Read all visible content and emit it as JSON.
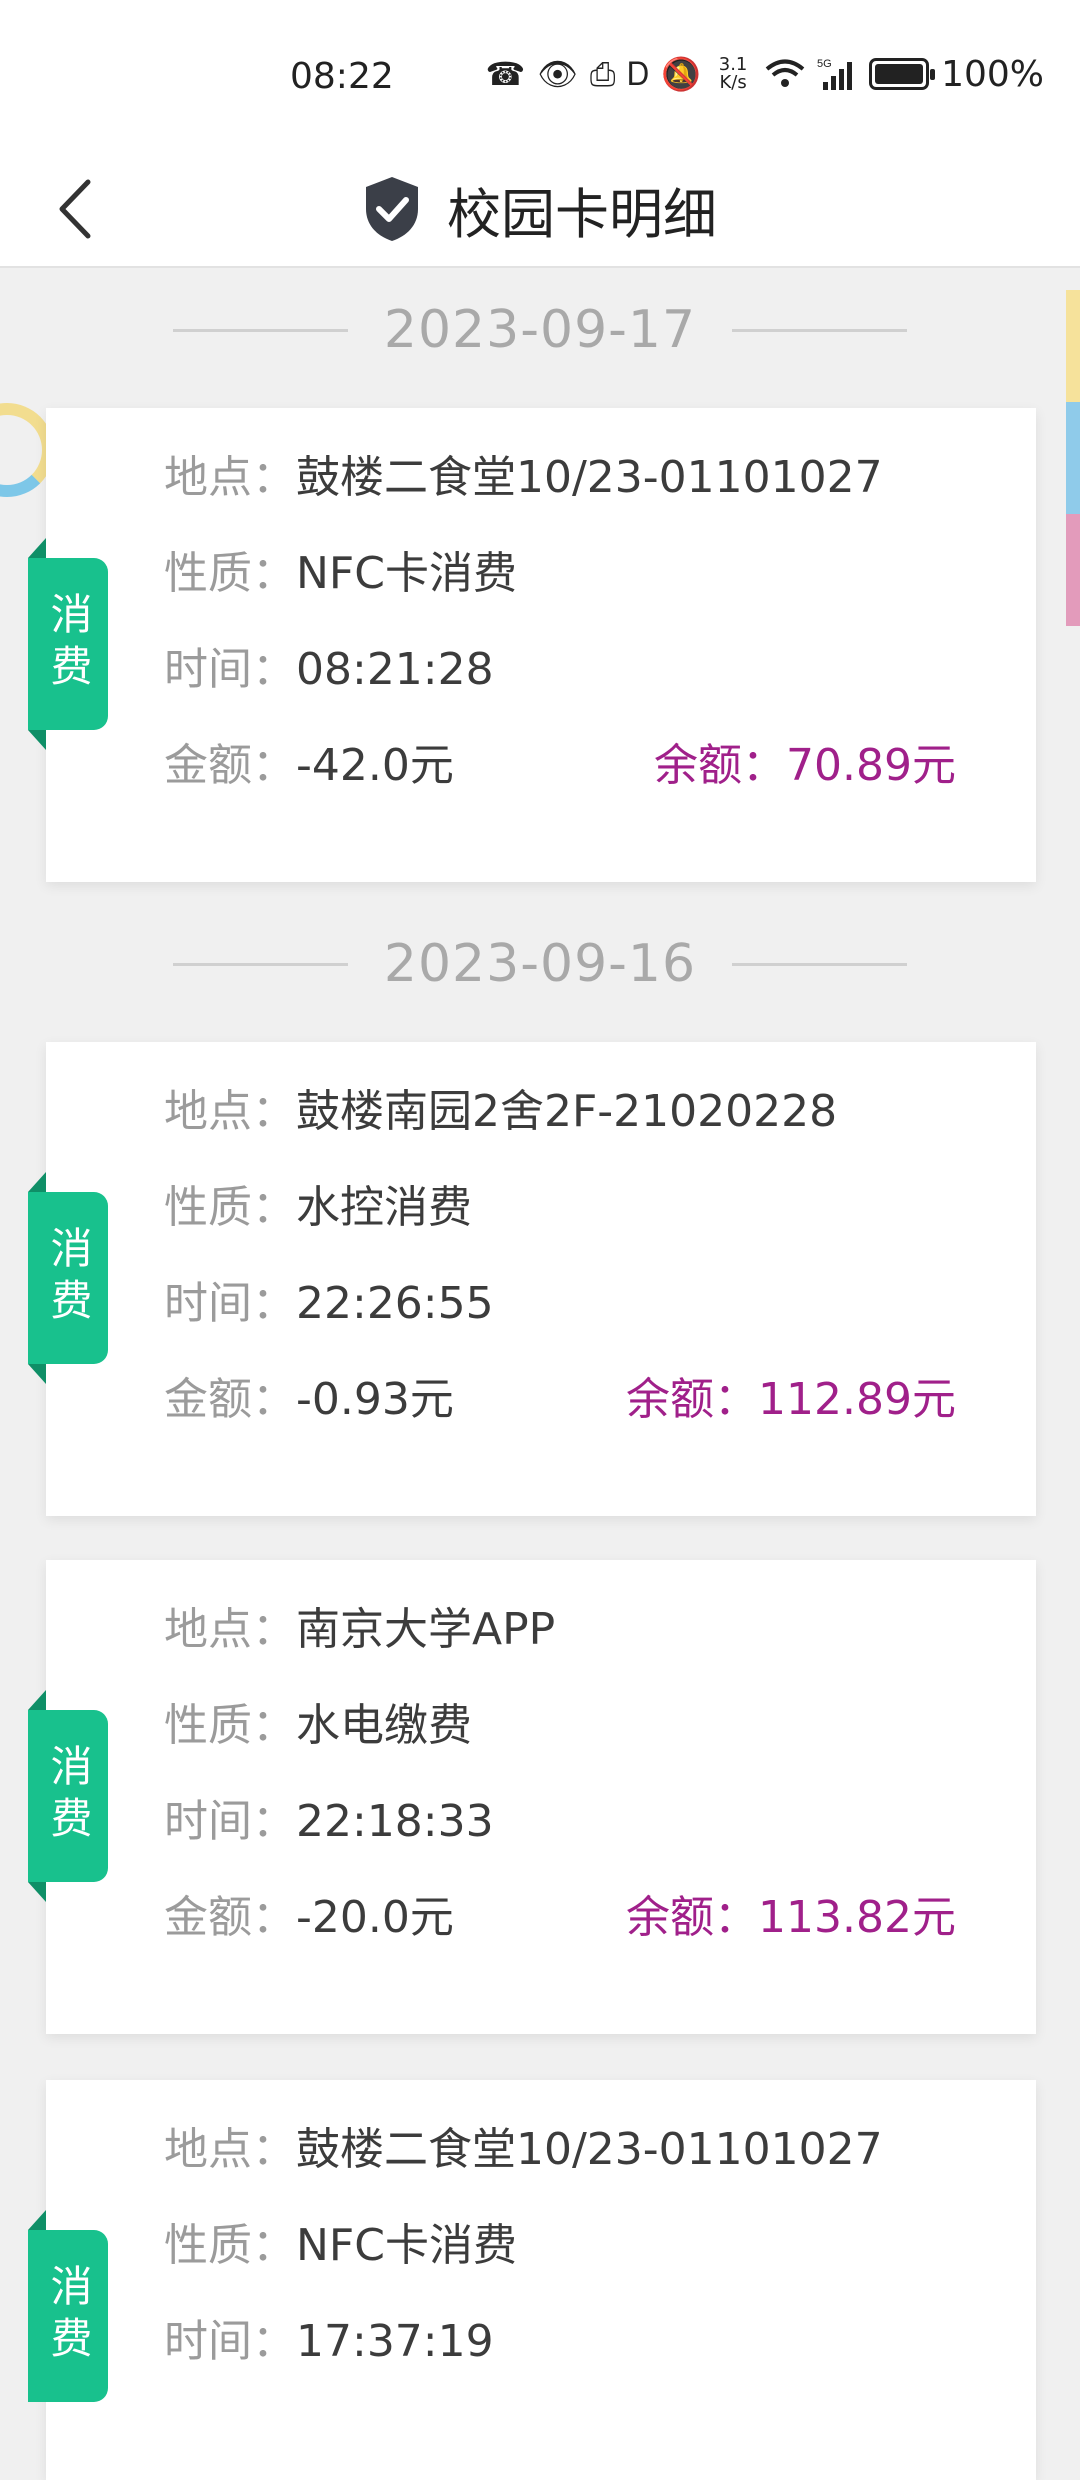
{
  "status_bar": {
    "time": "08:22",
    "speed": "3.1\nK/s",
    "battery_pct": "100%",
    "network": "5G"
  },
  "header": {
    "title": "校园卡明细",
    "back_icon": "chevron-left-icon",
    "shield_icon": "shield-check-icon"
  },
  "labels": {
    "location": "地点：",
    "nature": "性质：",
    "time": "时间：",
    "amount": "金额：",
    "balance": "余额："
  },
  "groups": [
    {
      "date": "2023-09-17",
      "records": [
        {
          "badge": "消费",
          "location": "鼓楼二食堂10/23-01101027",
          "nature": "NFC卡消费",
          "time": "08:21:28",
          "amount": "-42.0元",
          "balance": "余额：70.89元"
        }
      ]
    },
    {
      "date": "2023-09-16",
      "records": [
        {
          "badge": "消费",
          "location": "鼓楼南园2舍2F-21020228",
          "nature": "水控消费",
          "time": "22:26:55",
          "amount": "-0.93元",
          "balance": "余额：112.89元"
        },
        {
          "badge": "消费",
          "location": "南京大学APP",
          "nature": "水电缴费",
          "time": "22:18:33",
          "amount": "-20.0元",
          "balance": "余额：113.82元"
        },
        {
          "badge": "消费",
          "location": "鼓楼二食堂10/23-01101027",
          "nature": "NFC卡消费",
          "time": "17:37:19"
        }
      ]
    }
  ],
  "colors": {
    "badge": "#18c18d",
    "balance": "#a0208a",
    "side_tabs": [
      "#f6e29b",
      "#8fcbea",
      "#e39bbb"
    ]
  }
}
